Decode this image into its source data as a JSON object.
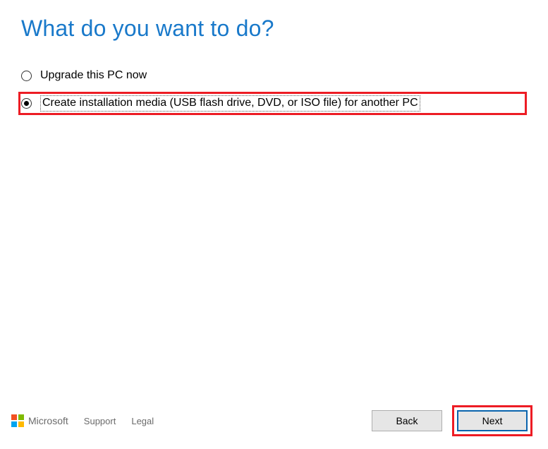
{
  "title": "What do you want to do?",
  "options": {
    "upgrade": {
      "label": "Upgrade this PC now",
      "selected": false
    },
    "createMedia": {
      "label": "Create installation media (USB flash drive, DVD, or ISO file) for another PC",
      "selected": true
    }
  },
  "footer": {
    "brand": "Microsoft",
    "links": {
      "support": "Support",
      "legal": "Legal"
    },
    "buttons": {
      "back": "Back",
      "next": "Next"
    }
  },
  "colors": {
    "highlight": "#ED1C24",
    "titleBlue": "#1979CA",
    "primaryBorder": "#0A64AD"
  }
}
